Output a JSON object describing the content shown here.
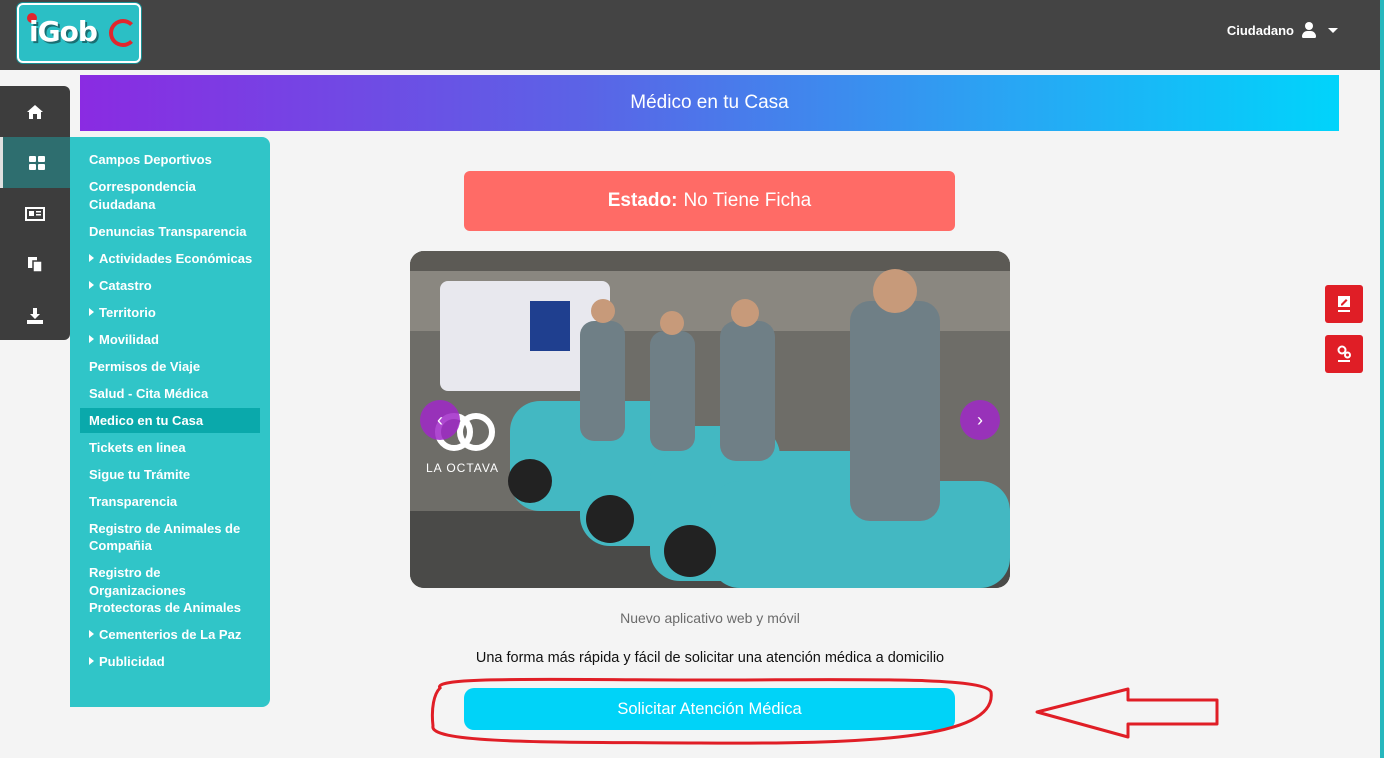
{
  "header": {
    "logo_text": "iGob",
    "user_label": "Ciudadano"
  },
  "icon_sidebar": [
    {
      "icon": "home-icon"
    },
    {
      "icon": "grid-icon",
      "active": true
    },
    {
      "icon": "newspaper-icon"
    },
    {
      "icon": "documents-icon"
    },
    {
      "icon": "download-icon"
    }
  ],
  "menu": {
    "items": [
      {
        "label": "Campos Deportivos"
      },
      {
        "label": "Correspondencia Ciudadana"
      },
      {
        "label": "Denuncias Transparencia"
      },
      {
        "label": "Actividades Económicas",
        "expandable": true
      },
      {
        "label": "Catastro",
        "expandable": true
      },
      {
        "label": "Territorio",
        "expandable": true
      },
      {
        "label": "Movilidad",
        "expandable": true
      },
      {
        "label": "Permisos de Viaje"
      },
      {
        "label": "Salud - Cita Médica"
      },
      {
        "label": "Medico en tu Casa",
        "active": true
      },
      {
        "label": "Tickets en linea"
      },
      {
        "label": "Sigue tu Trámite"
      },
      {
        "label": "Transparencia"
      },
      {
        "label": "Registro de Animales de Compañia"
      },
      {
        "label": "Registro de Organizaciones Protectoras de Animales"
      },
      {
        "label": "Cementerios de La Paz",
        "expandable": true
      },
      {
        "label": "Publicidad",
        "expandable": true
      }
    ]
  },
  "main": {
    "title": "Médico en tu Casa",
    "status_label": "Estado:",
    "status_value": "No Tiene Ficha",
    "carousel": {
      "prev": "‹",
      "next": "›",
      "watermark": "LA OCTAVA"
    },
    "caption": "Nuevo aplicativo web y móvil",
    "description": "Una forma más rápida y fácil de solicitar una atención médica a domicilio",
    "cta_label": "Solicitar Atención Médica"
  },
  "floating_buttons": [
    {
      "icon": "edit-document-icon"
    },
    {
      "icon": "settings-gears-icon"
    }
  ],
  "colors": {
    "topbar": "#444444",
    "teal": "#30c5c8",
    "status": "#ff6b66",
    "cta": "#00d3f8",
    "annotation": "#e01e26"
  }
}
